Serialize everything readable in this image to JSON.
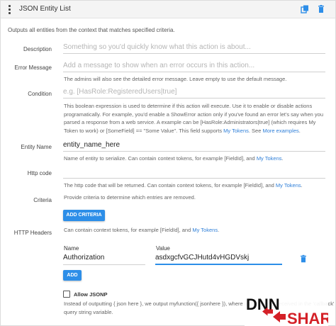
{
  "header": {
    "title": "JSON Entity List"
  },
  "description": "Outputs all entities from the context that matches specified criteria.",
  "fields": {
    "description": {
      "label": "Description",
      "placeholder": "Something so you'd quickly know what this action is about..."
    },
    "error_message": {
      "label": "Error Message",
      "placeholder": "Add a message to show when an error occurs in this action...",
      "help": "The admins will also see the detailed error message. Leave empty to use the default message."
    },
    "condition": {
      "label": "Condition",
      "placeholder": "e.g. [HasRole:RegisteredUsers|true]",
      "help_line1": "This boolean expression is used to determine if this action will execute. Use it to enable or disable actions",
      "help_line2": "programatically. For example, you'd enable a ShowError action only if you've found an error let's say when you",
      "help_line3": "parsed a response from a web service. A example can be [HasRole:Administrators|true] (which requires My",
      "help_line4_pre": "Token to work) or [SomeField] == \"Some Value\". This field supports ",
      "help_link1": "My Tokens",
      "help_mid": ". See ",
      "help_link2": "More examples",
      "help_end": "."
    },
    "entity_name": {
      "label": "Entity Name",
      "value": "entity_name_here",
      "help_pre": "Name of entity to serialize. Can contain context tokens, for example [FieldId], and ",
      "help_link": "My Tokens",
      "help_end": "."
    },
    "http_code": {
      "label": "Http code",
      "help_pre": "The http code that will be returned. Can contain context tokens, for example [FieldId], and ",
      "help_link": "My Tokens",
      "help_end": "."
    },
    "criteria": {
      "label": "Criteria",
      "help": "Provide criteria to determine which entries are removed.",
      "button": "ADD CRITERIA"
    },
    "http_headers": {
      "label": "HTTP Headers",
      "help_pre": "Can contain context tokens, for example [FieldId], and ",
      "help_link": "My Tokens",
      "help_end": ".",
      "col_name": "Name",
      "col_value": "Value",
      "row_name": "Authorization",
      "row_value": "asdxgcfvGCJHutd4vHGDVskj",
      "add_button": "ADD"
    },
    "allow_jsonp": {
      "label": "Allow JSONP",
      "checked": false,
      "help_line1": "Instead of outputting { json here }, we output myfunction({ jsonhere }), where myfunction is received in the 'callback'",
      "help_line2": "query string variable."
    }
  },
  "logo": {
    "text1": "DNN",
    "text2": "SHARP"
  },
  "colors": {
    "accent": "#2d8ee8",
    "link": "#2f7fd8",
    "logo_red": "#d42027"
  }
}
